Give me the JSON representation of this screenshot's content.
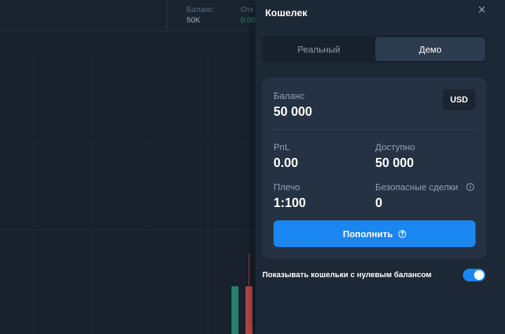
{
  "topbar": {
    "balance_label": "Баланс",
    "balance_value": "50K",
    "pnl_label": "Отк",
    "pnl_value": "0.00"
  },
  "wallet": {
    "title": "Кошелек",
    "close_icon": "close-icon",
    "tabs": [
      {
        "label": "Реальный",
        "active": false
      },
      {
        "label": "Демо",
        "active": true
      }
    ],
    "balance_label": "Баланс",
    "balance_value": "50 000",
    "currency": "USD",
    "pnl_label": "PnL",
    "pnl_value": "0.00",
    "available_label": "Доступно",
    "available_value": "50 000",
    "leverage_label": "Плечо",
    "leverage_value": "1:100",
    "safe_trades_label": "Безопасные сделки",
    "safe_trades_value": "0",
    "topup_label": "Пополнить",
    "show_zero_label": "Показывать кошельки с нулевым балансом",
    "show_zero_enabled": true
  },
  "colors": {
    "accent": "#1a86f2",
    "candle_up": "#26806a",
    "candle_down": "#b84a4a"
  }
}
